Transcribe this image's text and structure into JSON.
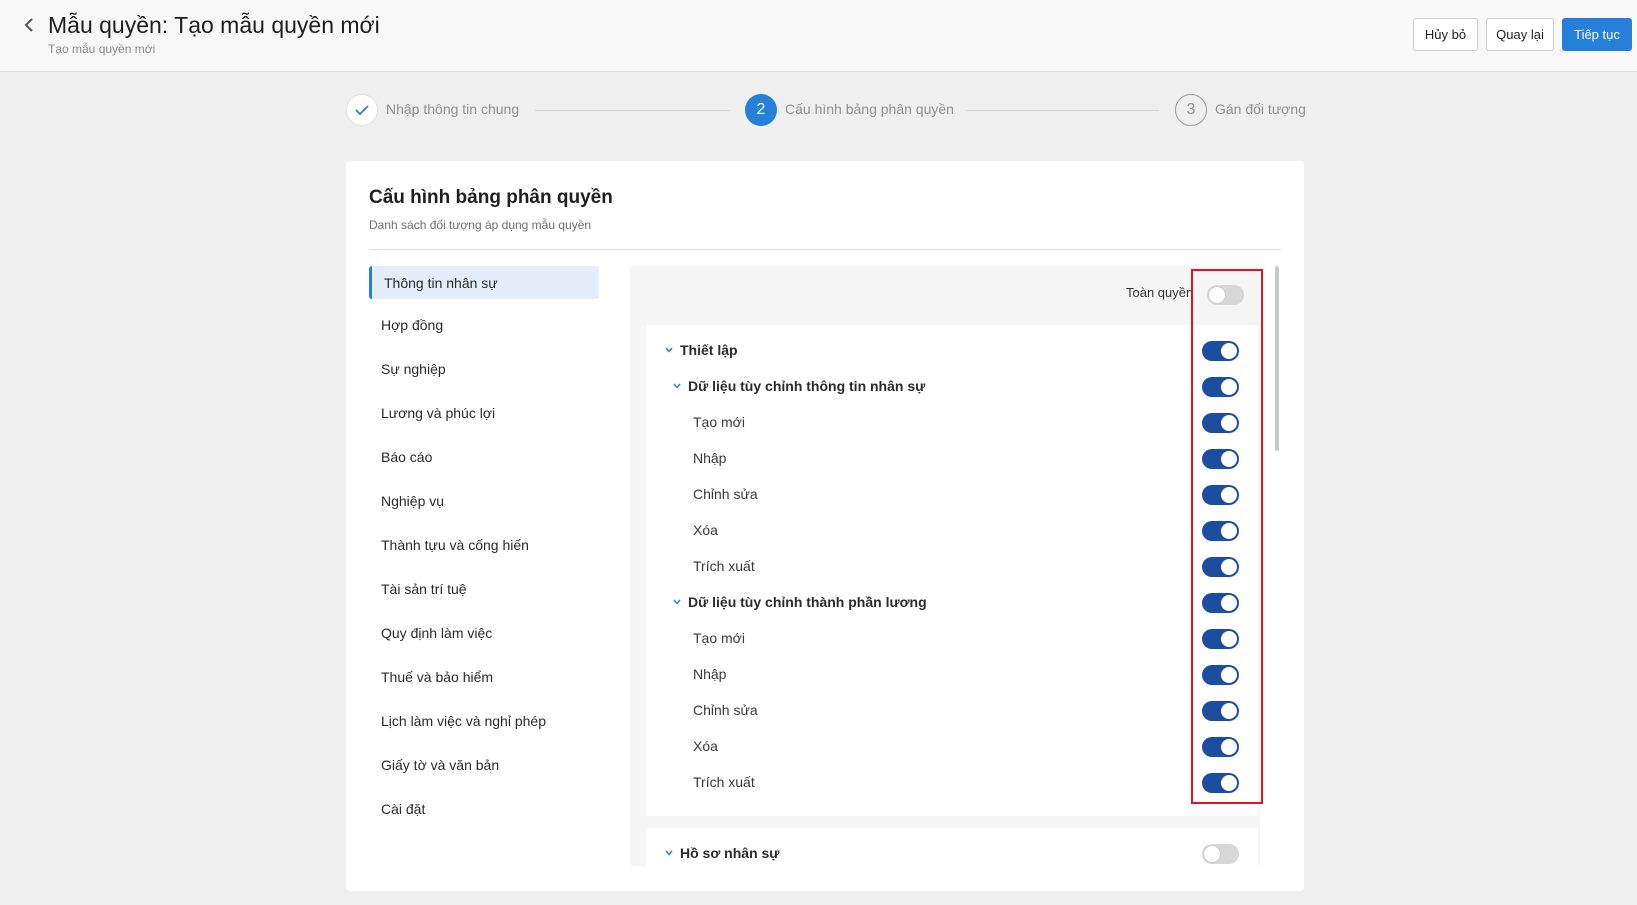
{
  "header": {
    "title": "Mẫu quyền: Tạo mẫu quyền mới",
    "subtitle": "Tạo mẫu quyền mới",
    "buttons": {
      "cancel": "Hủy bỏ",
      "back": "Quay lại",
      "next": "Tiếp tục"
    }
  },
  "stepper": {
    "steps": [
      {
        "number": "1",
        "label": "Nhập thông tin chung",
        "state": "completed"
      },
      {
        "number": "2",
        "label": "Cấu hình bảng phân quyền",
        "state": "active"
      },
      {
        "number": "3",
        "label": "Gán đối tượng",
        "state": "pending"
      }
    ]
  },
  "card": {
    "title": "Cấu hình bảng phân quyền",
    "subtitle": "Danh sách đối tượng áp dụng mẫu quyền"
  },
  "nav": {
    "items": [
      {
        "label": "Thông tin nhân sự",
        "active": true
      },
      {
        "label": "Hợp đồng"
      },
      {
        "label": "Sự nghiệp"
      },
      {
        "label": "Lương và phúc lợi"
      },
      {
        "label": "Báo cáo"
      },
      {
        "label": "Nghiệp vụ"
      },
      {
        "label": "Thành tựu và cống hiến"
      },
      {
        "label": "Tài sản trí tuệ"
      },
      {
        "label": "Quy định làm việc"
      },
      {
        "label": "Thuế và bảo hiểm"
      },
      {
        "label": "Lịch làm việc và nghỉ phép"
      },
      {
        "label": "Giấy tờ và văn bản"
      },
      {
        "label": "Cài đặt"
      }
    ]
  },
  "permissions": {
    "full_access_label": "Toàn quyền",
    "full_access_on": false,
    "groups": [
      {
        "label": "Thiết lập",
        "on": true,
        "subgroups": [
          {
            "label": "Dữ liệu tùy chỉnh thông tin nhân sự",
            "on": true,
            "items": [
              {
                "label": "Tạo mới",
                "on": true
              },
              {
                "label": "Nhập",
                "on": true
              },
              {
                "label": "Chỉnh sửa",
                "on": true
              },
              {
                "label": "Xóa",
                "on": true
              },
              {
                "label": "Trích xuất",
                "on": true
              }
            ]
          },
          {
            "label": "Dữ liệu tùy chỉnh thành phần lương",
            "on": true,
            "items": [
              {
                "label": "Tạo mới",
                "on": true
              },
              {
                "label": "Nhập",
                "on": true
              },
              {
                "label": "Chỉnh sửa",
                "on": true
              },
              {
                "label": "Xóa",
                "on": true
              },
              {
                "label": "Trích xuất",
                "on": true
              }
            ]
          }
        ]
      },
      {
        "label": "Hồ sơ nhân sự",
        "on": false
      }
    ]
  },
  "colors": {
    "primary": "#2680d9",
    "toggle_on": "#1b4ea1",
    "toggle_off": "#d7d7d7",
    "highlight": "#e3121e"
  }
}
